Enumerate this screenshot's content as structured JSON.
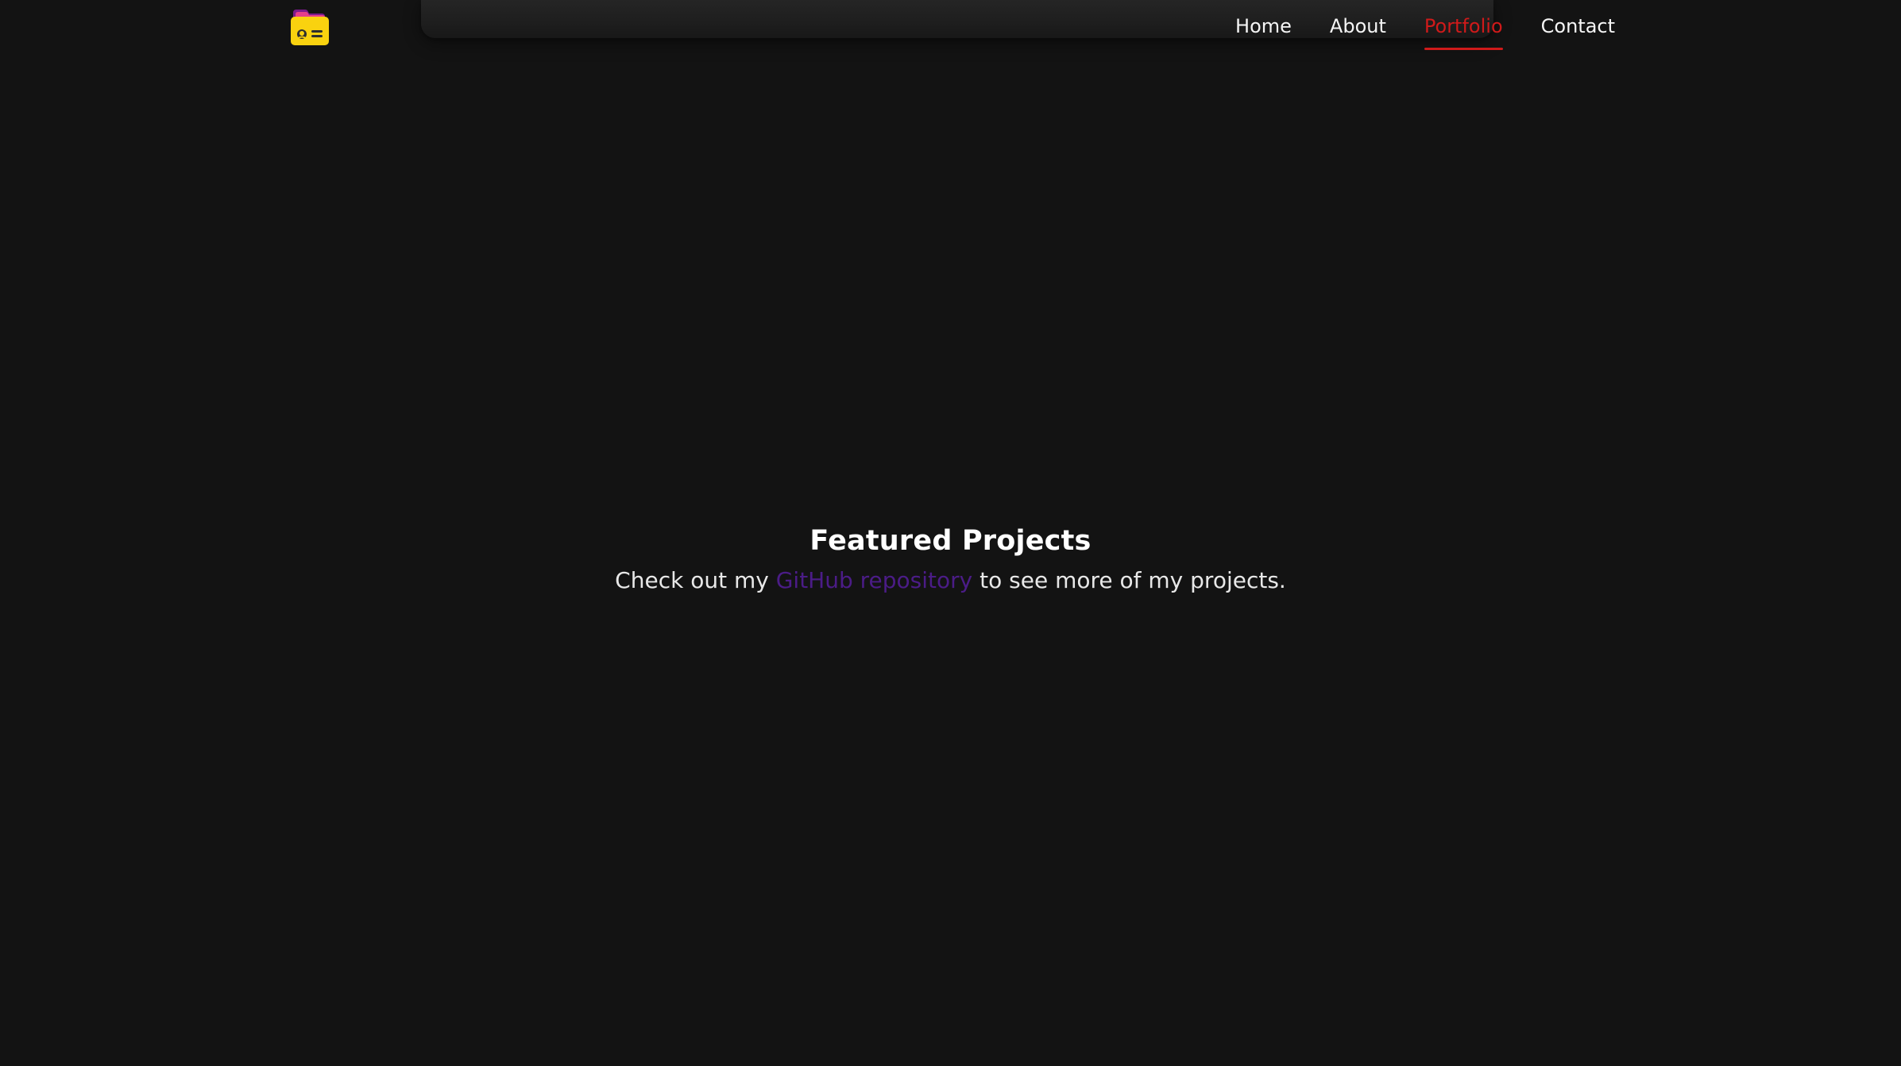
{
  "header": {
    "logo_icon": "portfolio-folder-logo-icon",
    "nav": {
      "items": [
        {
          "label": "Home",
          "active": false
        },
        {
          "label": "About",
          "active": false
        },
        {
          "label": "Portfolio",
          "active": true
        },
        {
          "label": "Contact",
          "active": false
        }
      ]
    }
  },
  "hero": {
    "title": "Featured Projects",
    "subtitle_before": "Check out my",
    "subtitle_link_text": "GitHub repository",
    "subtitle_after": "to see more of my projects."
  },
  "colors": {
    "background": "#131313",
    "active_nav": "#d01a1a",
    "link": "#4b1c87",
    "text": "#ffffff"
  }
}
